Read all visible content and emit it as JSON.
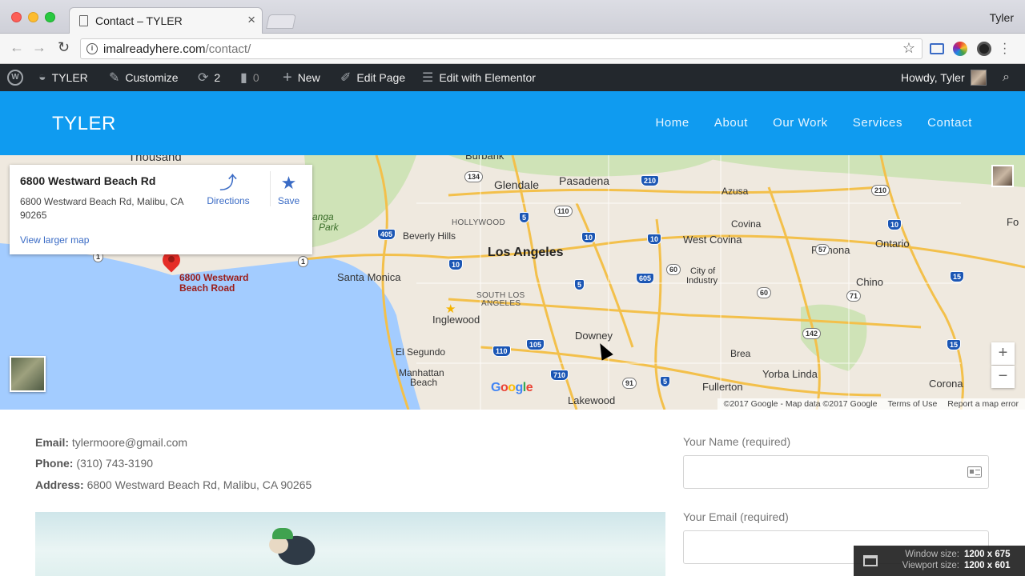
{
  "browser": {
    "tab_title": "Contact – TYLER",
    "tab_close": "×",
    "profile_name": "Tyler",
    "url_host": "imalreadyhere.com",
    "url_path": "/contact/",
    "back_glyph": "←",
    "forward_glyph": "→",
    "reload_glyph": "↻",
    "star_glyph": "☆"
  },
  "wp_admin": {
    "site_name": "TYLER",
    "customize": "Customize",
    "updates_count": "2",
    "comments_count": "0",
    "new": "New",
    "edit_page": "Edit Page",
    "edit_elementor": "Edit with Elementor",
    "howdy": "Howdy, Tyler"
  },
  "site": {
    "title": "TYLER",
    "nav": [
      "Home",
      "About",
      "Our Work",
      "Services",
      "Contact"
    ]
  },
  "map": {
    "card_title": "6800 Westward Beach Rd",
    "card_address": "6800 Westward Beach Rd, Malibu, CA 90265",
    "directions": "Directions",
    "save": "Save",
    "view_larger": "View larger map",
    "pin_label_line1": "6800 Westward",
    "pin_label_line2": "Beach Road",
    "labels": {
      "thousand": "Thousand",
      "burbank": "Burbank",
      "glendale": "Glendale",
      "pasadena": "Pasadena",
      "azusa": "Azusa",
      "hollywood": "HOLLYWOOD",
      "beverly_hills": "Beverly Hills",
      "los_angeles": "Los Angeles",
      "covina": "Covina",
      "west_covina": "West Covina",
      "ontario": "Ontario",
      "pomona": "Pomona",
      "chino": "Chino",
      "city_of_industry_1": "City of",
      "city_of_industry_2": "Industry",
      "santa_monica": "Santa Monica",
      "south_la_1": "SOUTH LOS",
      "south_la_2": "ANGELES",
      "inglewood": "Inglewood",
      "downey": "Downey",
      "el_segundo": "El Segundo",
      "manhattan_beach_1": "Manhattan",
      "manhattan_beach_2": "Beach",
      "brea": "Brea",
      "yorba_linda": "Yorba Linda",
      "fullerton": "Fullerton",
      "corona": "Corona",
      "lakewood": "Lakewood",
      "park_1": "anga",
      "park_2": "Park",
      "fontana_cut": "Fo"
    },
    "shields": [
      "134",
      "210",
      "210",
      "110",
      "5",
      "405",
      "10",
      "10",
      "10",
      "10",
      "57",
      "60",
      "60",
      "605",
      "5",
      "71",
      "15",
      "110",
      "105",
      "710",
      "91",
      "5",
      "142",
      "15",
      "1",
      "1"
    ],
    "google": [
      "G",
      "o",
      "o",
      "g",
      "l",
      "e"
    ],
    "zoom_in": "+",
    "zoom_out": "−",
    "attribution": "©2017 Google - Map data ©2017 Google",
    "terms": "Terms of Use",
    "report": "Report a map error"
  },
  "contact": {
    "email_label": "Email:",
    "email": "tylermoore@gmail.com",
    "phone_label": "Phone:",
    "phone": "(310) 743-3190",
    "address_label": "Address:",
    "address": "6800 Westward Beach Rd, Malibu, CA 90265",
    "name_label": "Your Name (required)",
    "email_field_label": "Your Email (required)"
  },
  "window_overlay": {
    "window_label": "Window size:",
    "window_value": "1200 x 675",
    "viewport_label": "Viewport size:",
    "viewport_value": "1200 x 601"
  },
  "colors": {
    "header_blue": "#0f9bf0",
    "wp_bar": "#23282d",
    "link_blue": "#3a6bc5",
    "pin_red": "#e52d27"
  }
}
